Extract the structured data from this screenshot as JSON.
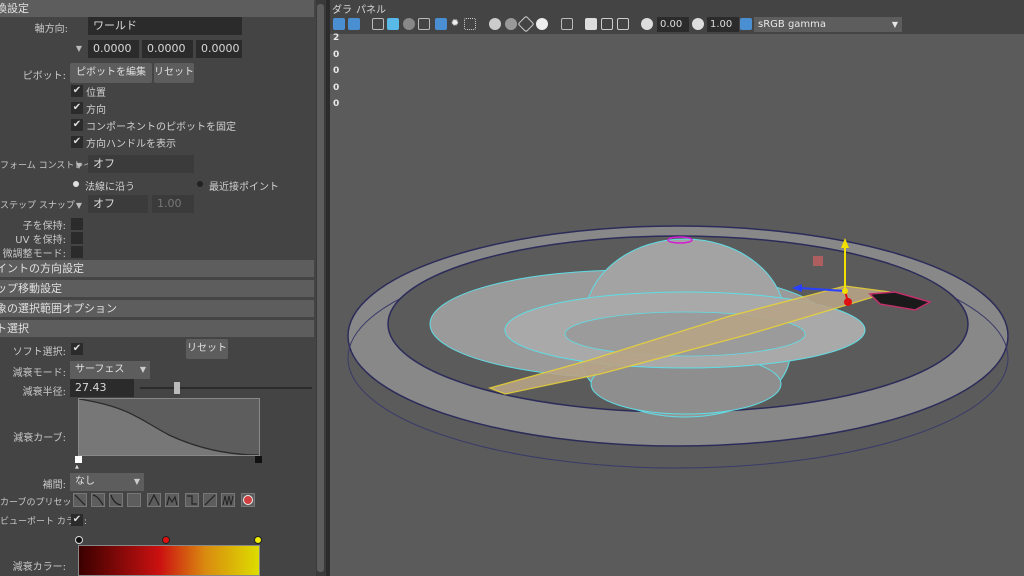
{
  "left_panel": {
    "section_top": "換設定",
    "axis_direction": {
      "label": "軸方向:",
      "value": "ワールド"
    },
    "axis_values": [
      "0.0000",
      "0.0000",
      "0.0000"
    ],
    "pivot": {
      "label": "ピボット:",
      "edit_button": "ピボットを編集",
      "reset_button": "リセット"
    },
    "checks": [
      {
        "label": "位置",
        "checked": true
      },
      {
        "label": "方向",
        "checked": true
      },
      {
        "label": "コンポーネントのピボットを固定",
        "checked": true
      },
      {
        "label": "方向ハンドルを表示",
        "checked": true
      }
    ],
    "transform_constraint": {
      "label": "フォーム コンストレイント:",
      "value": "オフ"
    },
    "constraint_options": [
      "法線に沿う",
      "最近接ポイント"
    ],
    "step_snap": {
      "label": "ステップ スナップ",
      "value": "オフ",
      "amount": "1.00"
    },
    "preserve": [
      {
        "label": "子を保持:"
      },
      {
        "label": "UV を保持:"
      },
      {
        "label": "微調整モード:"
      }
    ],
    "sections": [
      "イントの方向設定",
      "ップ移動設定",
      "象の選択範囲オプション",
      "ト選択"
    ],
    "soft_select": {
      "label": "ソフト選択:",
      "checked": true,
      "reset_button": "リセット"
    },
    "falloff_mode": {
      "label": "減衰モード:",
      "value": "サーフェス"
    },
    "falloff_radius": {
      "label": "減衰半径:",
      "value": "27.43",
      "slider": 0.2
    },
    "falloff_curve": {
      "label": "減衰カーブ:"
    },
    "interpolation": {
      "label": "補間:",
      "value": "なし"
    },
    "curve_presets": {
      "label": "カーブのプリセット:"
    },
    "viewport_color": {
      "label": "ビューポート カラー:",
      "checked": true
    },
    "falloff_color": {
      "label": "減衰カラー:"
    }
  },
  "viewport": {
    "menus": [
      "ダラ",
      "パネル"
    ],
    "exposure": "0.00",
    "gamma": "1.00",
    "color_space": "sRGB gamma",
    "hud_values": [
      "2",
      "0",
      "0",
      "0",
      "0"
    ]
  },
  "colors": {
    "panel_bg": "#444444",
    "viewport_bg": "#5b5b5b",
    "wire_cyan": "#5fdde6",
    "vertex_magenta": "#d41fd4",
    "selection_yellow": "#e8d13a",
    "ring_fill": "#8f8f8f"
  },
  "icons": [
    "camera-icon",
    "grid-icon",
    "wireframe-icon",
    "shaded-icon",
    "light-icon",
    "xray-icon",
    "isolate-icon",
    "exposure-icon",
    "gamma-icon",
    "colorspace-icon"
  ]
}
